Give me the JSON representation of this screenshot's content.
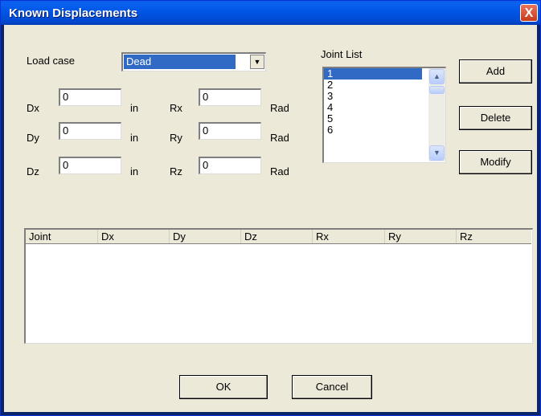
{
  "window": {
    "title": "Known Displacements",
    "close_label": "X"
  },
  "load_case": {
    "label": "Load case",
    "value": "Dead"
  },
  "rows": [
    {
      "d_label": "Dx",
      "d_value": "0",
      "d_unit": "in",
      "r_label": "Rx",
      "r_value": "0",
      "r_unit": "Rad"
    },
    {
      "d_label": "Dy",
      "d_value": "0",
      "d_unit": "in",
      "r_label": "Ry",
      "r_value": "0",
      "r_unit": "Rad"
    },
    {
      "d_label": "Dz",
      "d_value": "0",
      "d_unit": "in",
      "r_label": "Rz",
      "r_value": "0",
      "r_unit": "Rad"
    }
  ],
  "joint_list": {
    "label": "Joint List",
    "items": [
      "1",
      "2",
      "3",
      "4",
      "5",
      "6"
    ],
    "selected": "1"
  },
  "buttons": {
    "add": "Add",
    "delete": "Delete",
    "modify": "Modify",
    "ok": "OK",
    "cancel": "Cancel"
  },
  "table": {
    "columns": [
      "Joint",
      "Dx",
      "Dy",
      "Dz",
      "Rx",
      "Ry",
      "Rz"
    ],
    "rows": []
  }
}
